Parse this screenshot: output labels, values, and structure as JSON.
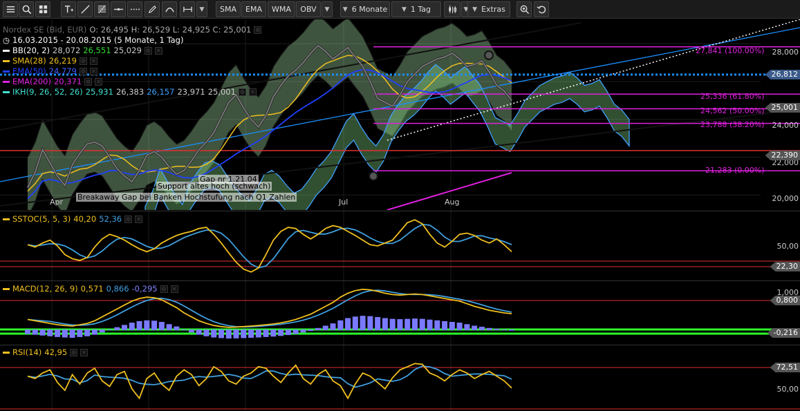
{
  "toolbar": {
    "buttons": [
      "SMA",
      "EMA",
      "WMA",
      "OBV"
    ],
    "timeframe": "6 Monate",
    "interval": "1 Tag",
    "extras": "Extras"
  },
  "price_panel": {
    "instrument": "Nordex SE (Bid, EUR)",
    "ohlc": "O: 26,495  H: 26,529  L: 24,925  C: 25,001",
    "range": "16.03.2015 - 20.08.2015 (5 Monate, 1 Tag)",
    "indicators": [
      {
        "name": "BB(20, 2)",
        "values": [
          "28,072",
          "26,551",
          "25,029"
        ],
        "color": "#ffffff",
        "value_colors": [
          "#cccccc",
          "#33dd33",
          "#cccccc"
        ]
      },
      {
        "name": "SMA(28)",
        "values": [
          "26,219"
        ],
        "color": "#f0c020",
        "value_colors": [
          "#f0c020"
        ]
      },
      {
        "name": "EMA(50)",
        "values": [
          "24,779"
        ],
        "color": "#2040ff",
        "value_colors": [
          "#4060ff"
        ]
      },
      {
        "name": "EMA(200)",
        "values": [
          "20,371"
        ],
        "color": "#e020e0",
        "value_colors": [
          "#e020e0"
        ]
      },
      {
        "name": "IKH(9, 26, 52, 26)",
        "values": [
          "25,931",
          "26,383",
          "26,157",
          "23,971",
          "25,001"
        ],
        "color": "#40e0d0",
        "value_colors": [
          "#40e0d0",
          "#cccccc",
          "#40a0ff",
          "#cccccc",
          "#cccccc"
        ]
      }
    ],
    "y_ticks": [
      "28,000",
      "24,000",
      "22,000",
      "20,000"
    ],
    "price_tags": [
      {
        "text": "26,812",
        "color": "#3a5a8a"
      },
      {
        "text": "25,001",
        "color": "#555555"
      },
      {
        "text": "22,390",
        "color": "#555555"
      }
    ],
    "fib_levels": [
      "27,841 (100.00%)",
      "25,336 (61.80%)",
      "24,562 (50.00%)",
      "23,788 (38.20%)",
      "21,283 (0.00%)"
    ],
    "annotations": [
      "Gap nr 1.21.04",
      "Support altes hoch (schwach)",
      "Breakaway Gap bei Banken Hochstufung nach Q1 Zahlen"
    ],
    "months": [
      "Apr",
      "Jul",
      "Aug"
    ]
  },
  "sstoc_panel": {
    "label": "SSTOC(5, 5, 3)",
    "values": [
      "40,20",
      "52,36"
    ],
    "value_colors": [
      "#f0c020",
      "#40a0e0"
    ],
    "y_ticks": [
      "50,00"
    ],
    "tags": [
      "22,30"
    ]
  },
  "macd_panel": {
    "label": "MACD(12, 26, 9)",
    "values": [
      "0,571",
      "0,866",
      "-0,295"
    ],
    "value_colors": [
      "#f0c020",
      "#40a0e0",
      "#8080ff"
    ],
    "y_ticks": [
      "1,000"
    ],
    "tags": [
      "0,800",
      "-0,216"
    ]
  },
  "rsi_panel": {
    "label": "RSI(14)",
    "values": [
      "42,95"
    ],
    "value_colors": [
      "#f0c020"
    ],
    "y_ticks": [
      "50,00"
    ],
    "tags": [
      "72,51"
    ]
  },
  "chart_data": {
    "type": "line",
    "title": "Nordex SE (Bid, EUR)",
    "x_range": [
      "16.03.2015",
      "20.08.2015"
    ],
    "ylim": [
      19.5,
      29.0
    ],
    "close_series": {
      "name": "Close",
      "values": [
        20.4,
        21.2,
        22.4,
        21.7,
        21.0,
        20.5,
        21.6,
        22.2,
        22.7,
        22.8,
        22.6,
        22.0,
        21.4,
        21.0,
        20.7,
        21.3,
        22.1,
        22.3,
        22.0,
        21.5,
        21.1,
        21.3,
        21.8,
        22.4,
        22.8,
        23.3,
        24.1,
        24.9,
        25.3,
        24.6,
        24.0,
        23.6,
        24.2,
        25.2,
        25.8,
        26.3,
        26.6,
        27.0,
        27.5,
        27.9,
        27.6,
        27.2,
        27.5,
        27.8,
        27.3,
        26.8,
        26.0,
        25.1,
        24.9,
        24.7,
        25.3,
        26.0,
        26.4,
        26.8,
        27.0,
        27.2,
        27.3,
        27.5,
        27.2,
        26.8,
        26.9,
        27.1,
        26.5,
        25.8,
        25.5,
        25.0
      ]
    },
    "fib_values": [
      27.841,
      25.336,
      24.562,
      23.788,
      21.283
    ],
    "sstoc": {
      "name": "SSTOC",
      "values": [
        52,
        48,
        55,
        60,
        50,
        35,
        28,
        25,
        30,
        48,
        62,
        70,
        66,
        60,
        52,
        45,
        40,
        45,
        55,
        62,
        68,
        72,
        75,
        80,
        82,
        70,
        55,
        38,
        22,
        10,
        5,
        12,
        35,
        60,
        75,
        82,
        80,
        70,
        62,
        70,
        80,
        85,
        82,
        75,
        68,
        60,
        52,
        50,
        55,
        60,
        75,
        90,
        95,
        88,
        70,
        55,
        48,
        58,
        70,
        72,
        68,
        60,
        55,
        62,
        52,
        40
      ]
    },
    "macd": {
      "name": "MACD",
      "values": [
        0.35,
        0.3,
        0.25,
        0.2,
        0.15,
        0.12,
        0.1,
        0.15,
        0.2,
        0.3,
        0.45,
        0.6,
        0.75,
        0.9,
        1.05,
        1.15,
        1.2,
        1.18,
        1.1,
        0.95,
        0.8,
        0.6,
        0.45,
        0.3,
        0.2,
        0.12,
        0.08,
        0.05,
        0.06,
        0.08,
        0.1,
        0.12,
        0.15,
        0.18,
        0.22,
        0.28,
        0.35,
        0.45,
        0.55,
        0.7,
        0.85,
        1.0,
        1.2,
        1.35,
        1.45,
        1.5,
        1.48,
        1.42,
        1.35,
        1.3,
        1.28,
        1.3,
        1.32,
        1.3,
        1.25,
        1.2,
        1.15,
        1.1,
        1.05,
        0.95,
        0.85,
        0.78,
        0.7,
        0.65,
        0.6,
        0.57
      ]
    },
    "rsi": {
      "name": "RSI",
      "values": [
        58,
        55,
        62,
        66,
        50,
        40,
        60,
        48,
        62,
        68,
        52,
        45,
        60,
        64,
        42,
        30,
        55,
        62,
        48,
        40,
        58,
        66,
        60,
        46,
        55,
        70,
        64,
        52,
        48,
        58,
        62,
        70,
        68,
        58,
        50,
        62,
        72,
        55,
        48,
        60,
        66,
        52,
        46,
        30,
        48,
        62,
        58,
        50,
        42,
        56,
        66,
        70,
        74,
        73,
        62,
        58,
        52,
        60,
        66,
        62,
        55,
        60,
        64,
        58,
        52,
        43
      ]
    }
  }
}
